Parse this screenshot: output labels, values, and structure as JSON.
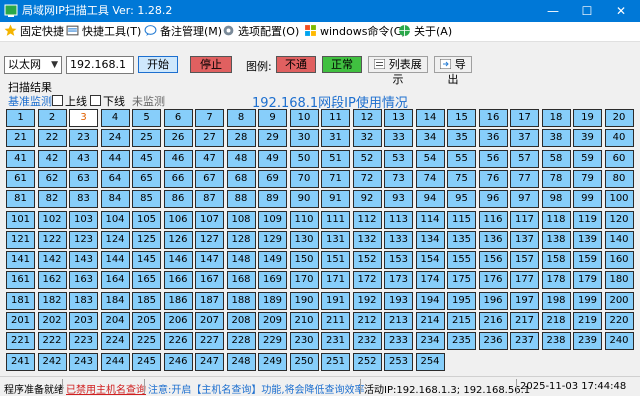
{
  "window": {
    "title": "局域网IP扫描工具    Ver: 1.28.2",
    "minimize": "—",
    "maximize": "☐",
    "close": "✕"
  },
  "menu": [
    {
      "label": "固定快捷",
      "icon": "star-icon"
    },
    {
      "label": "快捷工具(T)",
      "icon": "tools-icon"
    },
    {
      "label": "备注管理(M)",
      "icon": "note-icon"
    },
    {
      "label": "选项配置(O)",
      "icon": "settings-icon"
    },
    {
      "label": "windows命令(C)",
      "icon": "windows-icon"
    },
    {
      "label": "关于(A)",
      "icon": "globe-icon"
    }
  ],
  "controls": {
    "network_type": "以太网",
    "ip_prefix": "192.168.1",
    "start_label": "开始",
    "stop_label": "停止",
    "legend_label": "图例:",
    "legend_offline": "不通",
    "legend_online": "正常",
    "list_view_label": "列表展示",
    "export_label": "导出"
  },
  "scan": {
    "results_title": "扫描结果",
    "baseline_label": "基准监测",
    "online_label": "上线",
    "offline_label": "下线",
    "unmonitored_label": "未监测",
    "subnet_title": "192.168.1网段IP使用情况",
    "cells_start": 1,
    "cells_end": 254,
    "columns": 20,
    "highlighted": [
      3
    ]
  },
  "status": {
    "ready": "程序准备就绪",
    "hostname_disabled": "已禁用主机名查询",
    "notice": "注意:开启【主机名查询】功能,将会降低查询效率",
    "active_ip": "活动IP:192.168.1.3; 192.168.56.1",
    "datetime": "2025-11-03 17:44:48"
  },
  "colors": {
    "online": "#87cefa",
    "offline": "#e06060",
    "normal": "#40c040",
    "accent": "#1d6fcf"
  }
}
